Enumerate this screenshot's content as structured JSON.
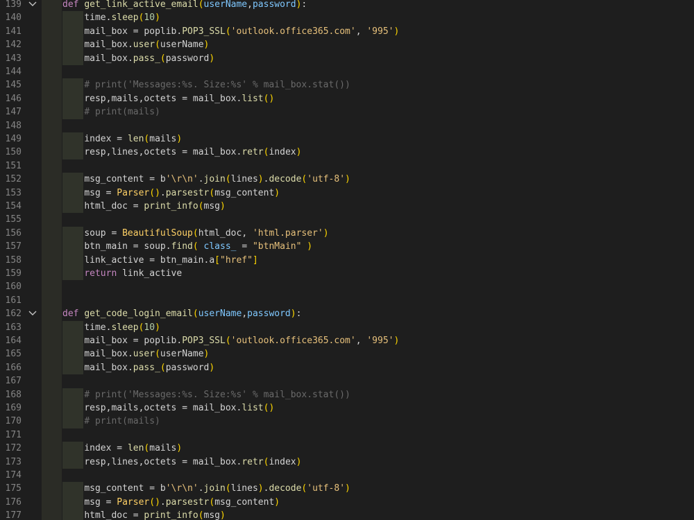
{
  "editor": {
    "lines": [
      {
        "n": "139",
        "fold": true,
        "code": "def get_link_active_email(userName,password):"
      },
      {
        "n": "140",
        "code": "    time.sleep(10)"
      },
      {
        "n": "141",
        "code": "    mail_box = poplib.POP3_SSL('outlook.office365.com', '995')"
      },
      {
        "n": "142",
        "code": "    mail_box.user(userName)"
      },
      {
        "n": "143",
        "code": "    mail_box.pass_(password)"
      },
      {
        "n": "144",
        "code": ""
      },
      {
        "n": "145",
        "code": "    # print('Messages:%s. Size:%s' % mail_box.stat())"
      },
      {
        "n": "146",
        "code": "    resp,mails,octets = mail_box.list()"
      },
      {
        "n": "147",
        "code": "    # print(mails)"
      },
      {
        "n": "148",
        "code": ""
      },
      {
        "n": "149",
        "code": "    index = len(mails)"
      },
      {
        "n": "150",
        "code": "    resp,lines,octets = mail_box.retr(index)"
      },
      {
        "n": "151",
        "code": ""
      },
      {
        "n": "152",
        "code": "    msg_content = b'\\r\\n'.join(lines).decode('utf-8')"
      },
      {
        "n": "153",
        "code": "    msg = Parser().parsestr(msg_content)"
      },
      {
        "n": "154",
        "code": "    html_doc = print_info(msg)"
      },
      {
        "n": "155",
        "code": ""
      },
      {
        "n": "156",
        "code": "    soup = BeautifulSoup(html_doc, 'html.parser')"
      },
      {
        "n": "157",
        "code": "    btn_main = soup.find( class_ = \"btnMain\" )"
      },
      {
        "n": "158",
        "code": "    link_active = btn_main.a[\"href\"]"
      },
      {
        "n": "159",
        "code": "    return link_active"
      },
      {
        "n": "160",
        "code": ""
      },
      {
        "n": "161",
        "code": ""
      },
      {
        "n": "162",
        "fold": true,
        "code": "def get_code_login_email(userName,password):"
      },
      {
        "n": "163",
        "code": "    time.sleep(10)"
      },
      {
        "n": "164",
        "code": "    mail_box = poplib.POP3_SSL('outlook.office365.com', '995')"
      },
      {
        "n": "165",
        "code": "    mail_box.user(userName)"
      },
      {
        "n": "166",
        "code": "    mail_box.pass_(password)"
      },
      {
        "n": "167",
        "code": ""
      },
      {
        "n": "168",
        "code": "    # print('Messages:%s. Size:%s' % mail_box.stat())"
      },
      {
        "n": "169",
        "code": "    resp,mails,octets = mail_box.list()"
      },
      {
        "n": "170",
        "code": "    # print(mails)"
      },
      {
        "n": "171",
        "code": ""
      },
      {
        "n": "172",
        "code": "    index = len(mails)"
      },
      {
        "n": "173",
        "code": "    resp,lines,octets = mail_box.retr(index)"
      },
      {
        "n": "174",
        "code": ""
      },
      {
        "n": "175",
        "code": "    msg_content = b'\\r\\n'.join(lines).decode('utf-8')"
      },
      {
        "n": "176",
        "code": "    msg = Parser().parsestr(msg_content)"
      },
      {
        "n": "177",
        "code": "    html_doc = print_info(msg)"
      }
    ]
  }
}
